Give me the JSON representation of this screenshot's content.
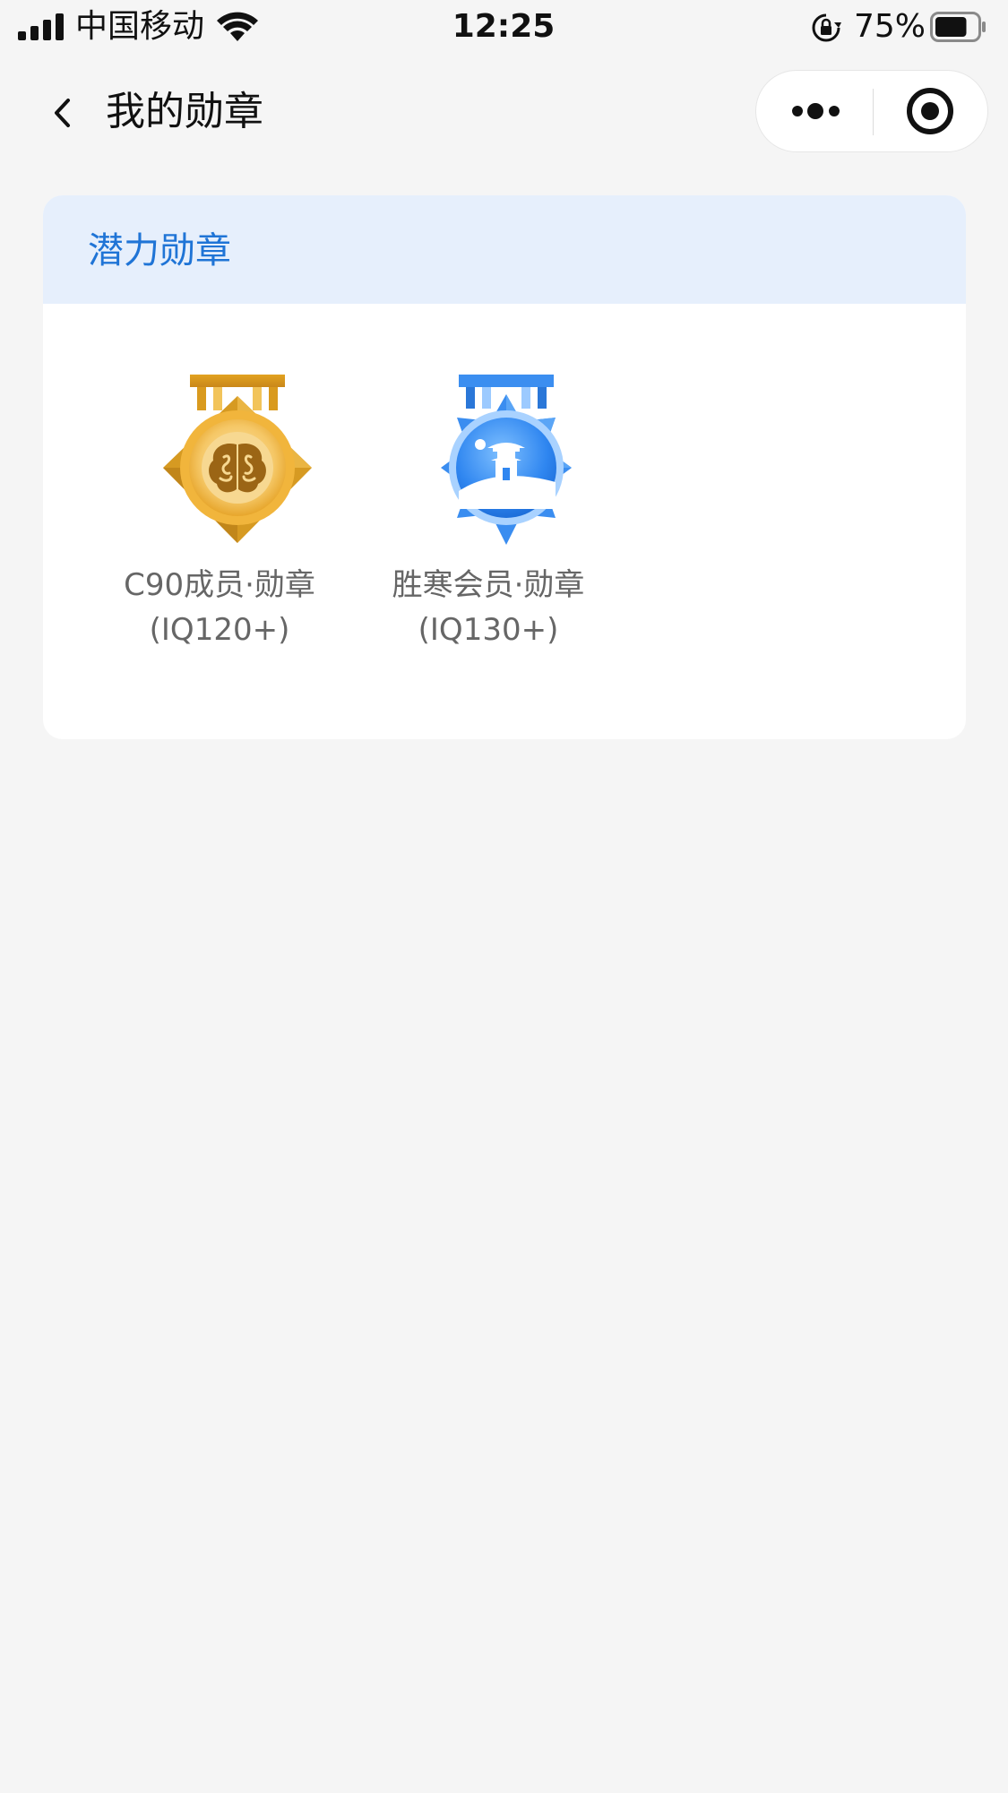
{
  "status_bar": {
    "carrier": "中国移动",
    "time": "12:25",
    "battery_percent": "75%",
    "battery_level": 0.75,
    "icons": [
      "signal-icon",
      "wifi-icon",
      "orientation-lock-icon",
      "battery-icon"
    ]
  },
  "nav": {
    "title": "我的勋章",
    "back_icon": "chevron-left-icon",
    "more_icon": "more-dots-icon",
    "close_icon": "target-close-icon"
  },
  "section": {
    "title": "潜力勋章",
    "badges": [
      {
        "name_line1": "C90成员·勋章",
        "name_line2": "(IQ120+)",
        "icon": "brain-medal-icon",
        "color": "#f0b43a"
      },
      {
        "name_line1": "胜寒会员·勋章",
        "name_line2": "(IQ130+)",
        "icon": "pavilion-medal-icon",
        "color": "#2f86f0"
      }
    ]
  },
  "colors": {
    "page_background": "#f5f5f5",
    "section_header_bg": "#e6effc",
    "section_title": "#1f74d6",
    "badge_label": "#666666"
  }
}
